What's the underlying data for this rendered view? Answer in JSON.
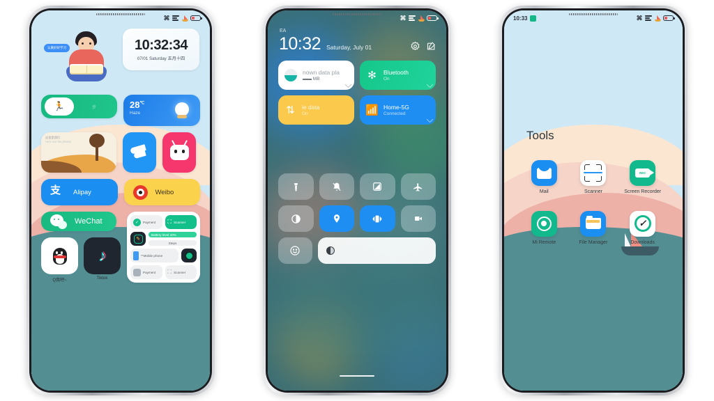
{
  "scene": {
    "title": "MIUI theme preview - three phone mockups",
    "background_color": "#ffffff"
  },
  "phone1": {
    "statusbar": {
      "icons": [
        "bluetooth-icon",
        "signal-icon",
        "boat-icon",
        "battery-icon"
      ]
    },
    "boy_widget": {
      "bubble_text": "认真好好学习",
      "name": "study-boy-illustration"
    },
    "clock_widget": {
      "time": "10:32:34",
      "date": "07/01 Saturday 五月十四"
    },
    "fitness_widget": {
      "icon": "running-icon",
      "value": "步"
    },
    "weather_widget": {
      "temperature": "28",
      "unit": "℃",
      "condition": "Haze",
      "icon": "sun-icon"
    },
    "desert_widget": {
      "caption_cn": "这里是我们",
      "caption_en": "Here are the photos"
    },
    "apps": [
      {
        "name": "Alipay",
        "label": "Alipay",
        "color": "#1b8ef2"
      },
      {
        "name": "Weibo",
        "label": "Weibo",
        "color": "#fbd24c"
      },
      {
        "name": "WeChat",
        "label": "WeChat",
        "color": "#17b981"
      },
      {
        "name": "QQ",
        "label": "Q我吧~",
        "color": "#ffffff"
      },
      {
        "name": "Tiktok",
        "label": "Tiktok",
        "color": "#1f2630"
      }
    ],
    "shortcut_widget": {
      "items": [
        {
          "label": "Payment",
          "style": "light"
        },
        {
          "label": "Scanner",
          "style": "green"
        },
        {
          "label": "",
          "style": "dark-pen"
        },
        {
          "label": "Battery level 40%",
          "style": "greenlt"
        },
        {
          "label": "Steps",
          "style": "light"
        },
        {
          "label": "**Mobile phone",
          "style": "light"
        },
        {
          "label": "",
          "style": "dark-ring"
        },
        {
          "label": "Payment",
          "style": "light"
        },
        {
          "label": "Scanner",
          "style": "light"
        }
      ]
    }
  },
  "phone2": {
    "carrier": "EA",
    "statusbar": {
      "icons": [
        "bluetooth-icon",
        "signal-icon",
        "boat-icon",
        "battery-icon"
      ]
    },
    "header": {
      "time": "10:32",
      "date": "Saturday, July 01",
      "settings_icon": "gear-icon",
      "edit_icon": "edit-icon"
    },
    "tiles": [
      {
        "name": "data-plan",
        "title": "nown data pla",
        "sub": "▬▬ MB",
        "style": "white",
        "icon": "data-usage-icon"
      },
      {
        "name": "bluetooth",
        "title": "Bluetooth",
        "sub": "On",
        "style": "green",
        "icon": "bluetooth-icon"
      },
      {
        "name": "mobile-data",
        "title": "le data",
        "sub": "On",
        "style": "yellow",
        "icon": "mobile-data-icon"
      },
      {
        "name": "wifi",
        "title": "Home-5G",
        "sub": "Connected",
        "style": "blue",
        "icon": "wifi-icon"
      }
    ],
    "toggles": [
      {
        "name": "flashlight",
        "icon": "flashlight-icon",
        "active": false
      },
      {
        "name": "silent",
        "icon": "bell-off-icon",
        "active": false
      },
      {
        "name": "screenshot",
        "icon": "screenshot-icon",
        "active": false
      },
      {
        "name": "airplane-mode",
        "icon": "airplane-icon",
        "active": false
      },
      {
        "name": "dark-mode",
        "icon": "contrast-icon",
        "active": false
      },
      {
        "name": "location",
        "icon": "location-pin-icon",
        "active": true
      },
      {
        "name": "sound-vibrate",
        "icon": "vibrate-icon",
        "active": true
      },
      {
        "name": "screen-recorder",
        "icon": "video-camera-icon",
        "active": false
      },
      {
        "name": "mood",
        "icon": "smiley-icon",
        "active": false
      }
    ],
    "brightness": {
      "name": "brightness-slider",
      "icon": "brightness-icon",
      "value_percent": 88
    }
  },
  "phone3": {
    "statusbar": {
      "time": "10:33",
      "left_icon": "app-badge-icon",
      "icons": [
        "bluetooth-icon",
        "signal-icon",
        "boat-icon",
        "battery-icon"
      ]
    },
    "folder": {
      "title": "Tools",
      "apps": [
        {
          "label": "Mail",
          "icon": "mail-icon"
        },
        {
          "label": "Scanner",
          "icon": "scanner-icon"
        },
        {
          "label": "Screen Recorder",
          "icon": "screen-recorder-icon"
        },
        {
          "label": "Mi Remote",
          "icon": "remote-control-icon"
        },
        {
          "label": "File Manager",
          "icon": "folder-icon"
        },
        {
          "label": "Downloads",
          "icon": "check-circle-icon"
        }
      ]
    }
  }
}
